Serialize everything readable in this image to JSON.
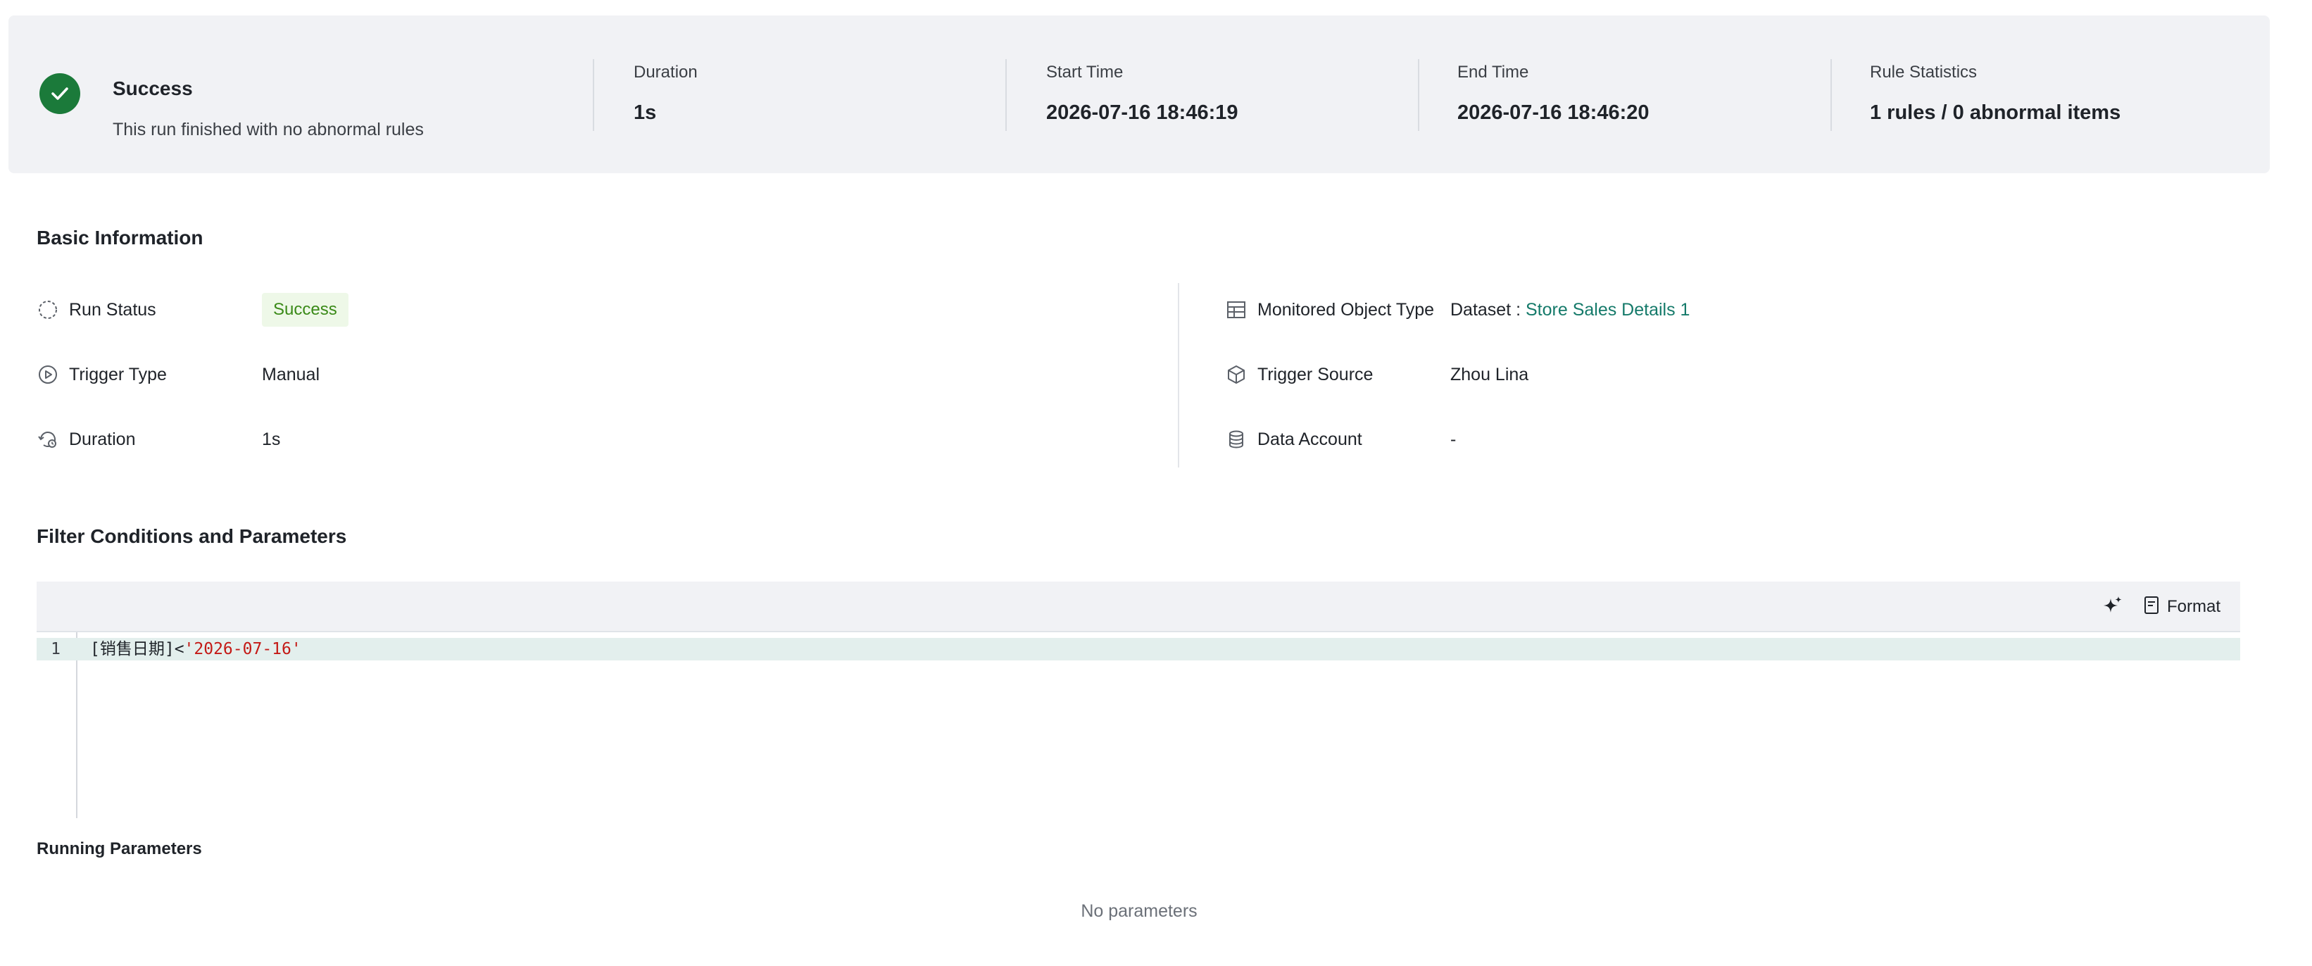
{
  "summary": {
    "status_title": "Success",
    "status_subtitle": "This run finished with no abnormal rules",
    "duration_label": "Duration",
    "duration_value": "1s",
    "start_label": "Start Time",
    "start_value": "2026-07-16 18:46:19",
    "end_label": "End Time",
    "end_value": "2026-07-16 18:46:20",
    "rules_label": "Rule Statistics",
    "rules_value": "1 rules / 0 abnormal items"
  },
  "basic_info": {
    "title": "Basic Information",
    "run_status_label": "Run Status",
    "run_status_value": "Success",
    "trigger_type_label": "Trigger Type",
    "trigger_type_value": "Manual",
    "duration_label": "Duration",
    "duration_value": "1s",
    "object_type_label": "Monitored Object Type",
    "object_type_prefix": "Dataset : ",
    "object_type_link": "Store Sales Details 1",
    "trigger_source_label": "Trigger Source",
    "trigger_source_value": "Zhou Lina",
    "data_account_label": "Data Account",
    "data_account_value": "-"
  },
  "filter": {
    "title": "Filter Conditions and Parameters",
    "format_label": "Format",
    "line_number": "1",
    "code_prefix": "[销售日期]<",
    "code_string": "'2026-07-16'"
  },
  "running_params": {
    "title": "Running Parameters",
    "empty_text": "No parameters"
  },
  "colors": {
    "success_green": "#1b7a3a",
    "badge_bg": "#eef8e8",
    "badge_text": "#3a8a18",
    "link": "#157a6a",
    "string_literal": "#c41a16",
    "banner_bg": "#f1f2f5"
  }
}
